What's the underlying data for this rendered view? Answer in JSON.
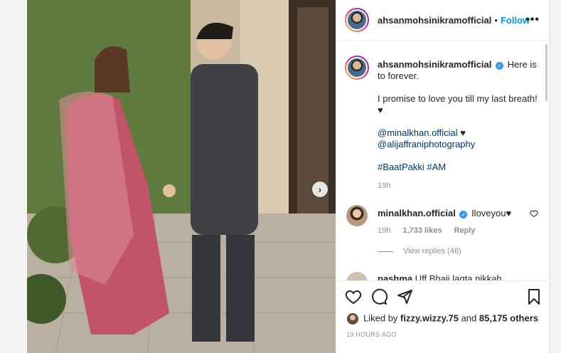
{
  "post": {
    "username": "ahsanmohsinikramofficial",
    "dot": "•",
    "follow_label": "Follow",
    "more_label": "•••",
    "next_label": "›"
  },
  "caption": {
    "username": "ahsanmohsinikramofficial",
    "line1": "Here is to forever.",
    "line2": "I promise to love you till my last breath! ♥",
    "mention1": "@minalkhan.official",
    "mention1_suffix": " ♥",
    "mention2": "@alijaffraniphotography",
    "hashtags": "#BaatPakki #AM",
    "time": "19h"
  },
  "comment": {
    "username": "minalkhan.official",
    "text": "Iloveyou♥",
    "time": "19h",
    "likes": "1,733 likes",
    "reply_label": "Reply",
    "view_replies": "View replies (46)"
  },
  "partial_comment": {
    "username": "pashma",
    "text": "Uff Bhaii lagta nikkah"
  },
  "actions": {
    "liked_by_prefix": "Liked by",
    "liked_by_user": "fizzy.wizzy.75",
    "liked_by_and": "and",
    "liked_by_others": "85,175 others",
    "posted_time": "19 HOURS AGO"
  }
}
